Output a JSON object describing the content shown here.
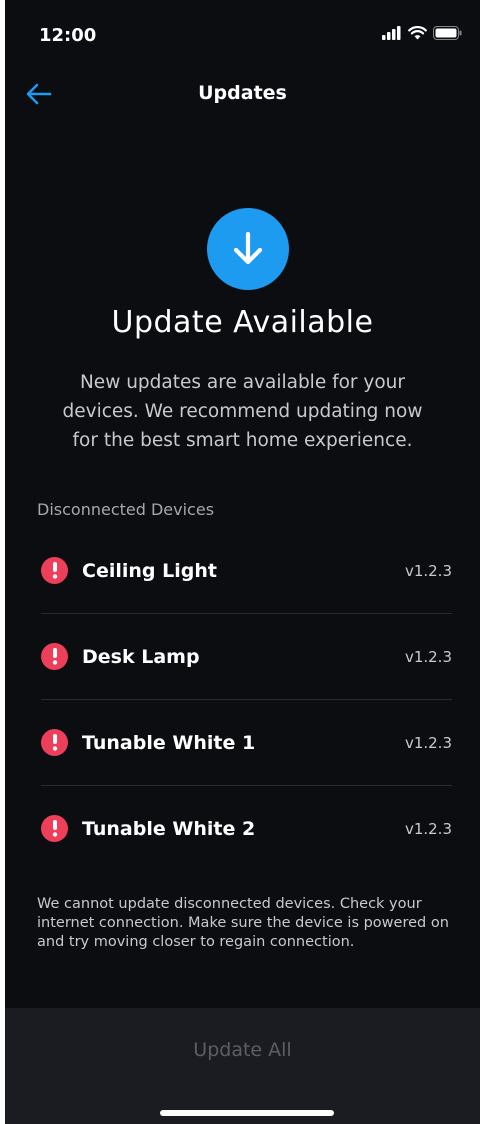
{
  "status_bar": {
    "time": "12:00",
    "icons": [
      "signal-icon",
      "wifi-icon",
      "battery-icon"
    ]
  },
  "header": {
    "back_icon": "arrow-left-icon",
    "title": "Updates"
  },
  "hero": {
    "icon": "download-arrow-icon",
    "title": "Update Available",
    "description": "New updates are available for your devices. We recommend updating now for the best smart home experience."
  },
  "devices": {
    "section_label": "Disconnected Devices",
    "items": [
      {
        "name": "Ceiling Light",
        "version": "v1.2.3"
      },
      {
        "name": "Desk Lamp",
        "version": "v1.2.3"
      },
      {
        "name": "Tunable White 1",
        "version": "v1.2.3"
      },
      {
        "name": "Tunable White 2",
        "version": "v1.2.3"
      }
    ]
  },
  "footer": {
    "note": "We cannot update disconnected devices. Check your internet connection. Make sure the device is powered on and try moving closer to regain connection.",
    "button_label": "Update All"
  },
  "colors": {
    "background": "#0c0d11",
    "accent": "#1d9bf0",
    "alert": "#ee3f5a",
    "panel": "#1b1c21",
    "disabled_text": "#5d5e64"
  }
}
